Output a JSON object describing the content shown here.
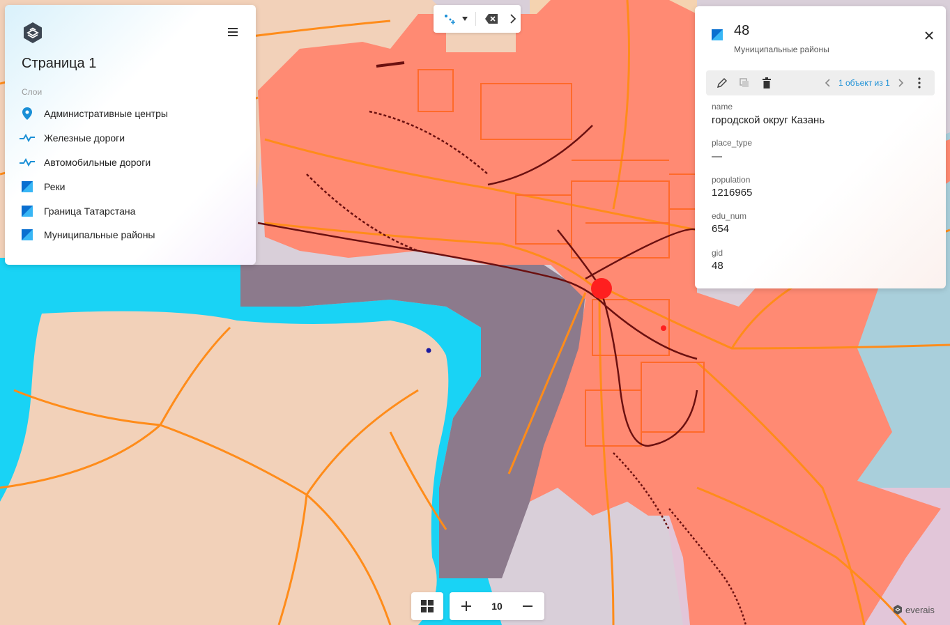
{
  "colors": {
    "accent": "#1a8fd6",
    "municipal_district": "#ff8a73",
    "water": "#19d3f5",
    "land_other": "#f2d1b9",
    "river_area": "#8c7a8c",
    "roads": "#ff8c1a",
    "railways": "#6b1010",
    "admin_center": "#ff1f1f"
  },
  "layers_panel": {
    "page_title": "Страница 1",
    "layers_caption": "Слои",
    "menu_icon": "hamburger-icon",
    "logo_icon": "layers-logo-icon",
    "layers": [
      {
        "label": "Административные центры",
        "icon": "map-pin-icon"
      },
      {
        "label": "Железные дороги",
        "icon": "polyline-icon"
      },
      {
        "label": "Автомобильные дороги",
        "icon": "polyline-icon"
      },
      {
        "label": "Реки",
        "icon": "polygon-swatch-icon"
      },
      {
        "label": "Граница Татарстана",
        "icon": "polygon-swatch-icon"
      },
      {
        "label": "Муниципальные районы",
        "icon": "polygon-swatch-icon"
      }
    ]
  },
  "top_toolbar": {
    "add_point_icon": "add-point-icon",
    "dropdown_icon": "caret-down-icon",
    "erase_icon": "backspace-icon",
    "expand_icon": "chevron-right-icon"
  },
  "info_panel": {
    "feature_id": "48",
    "layer_name": "Муниципальные районы",
    "pager": "1 объект из 1",
    "attributes": [
      {
        "key": "name",
        "value": "городской округ Казань"
      },
      {
        "key": "place_type",
        "value": "—"
      },
      {
        "key": "population",
        "value": "1216965"
      },
      {
        "key": "edu_num",
        "value": "654"
      },
      {
        "key": "gid",
        "value": "48"
      }
    ]
  },
  "zoom": {
    "level": "10"
  },
  "brand": {
    "name": "everais"
  }
}
